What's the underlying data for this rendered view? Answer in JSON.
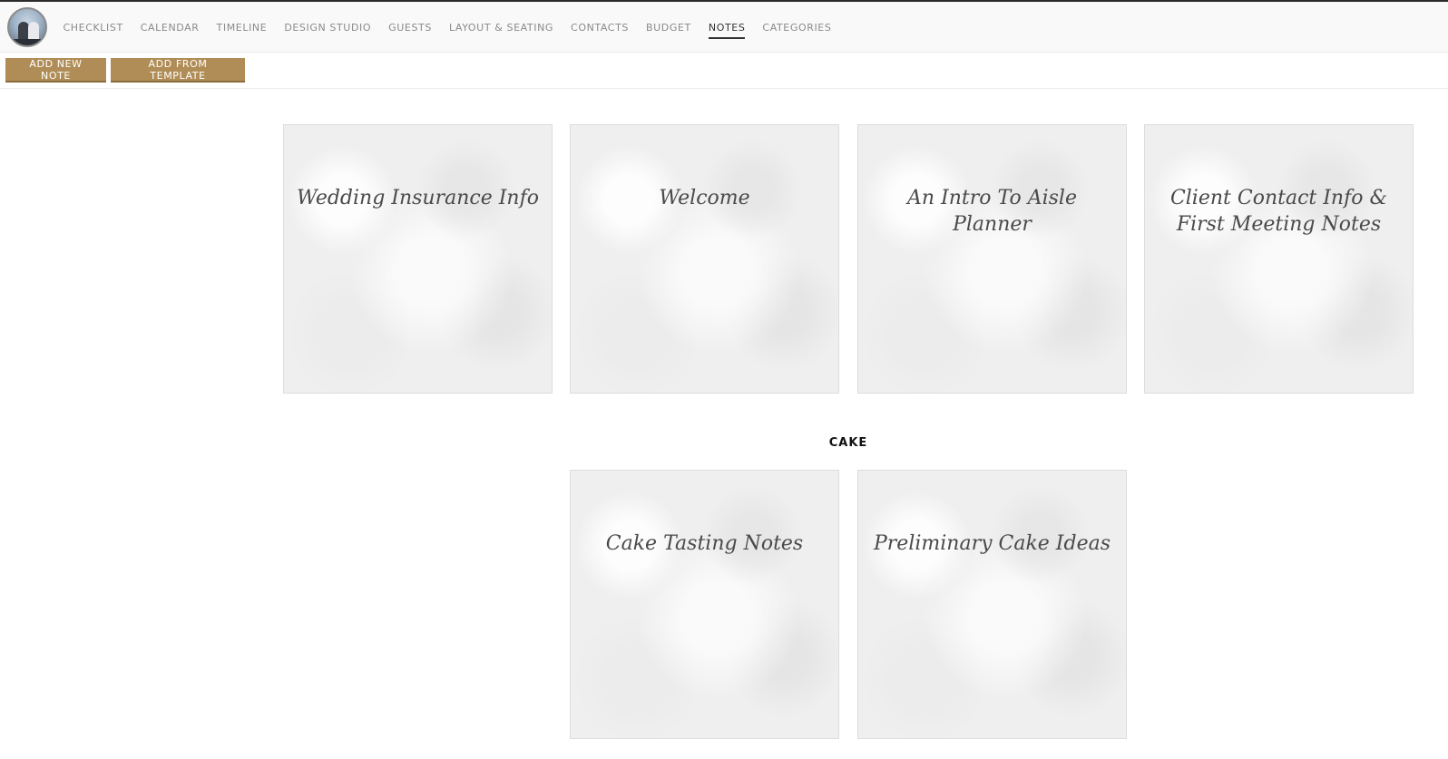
{
  "nav": {
    "items": [
      {
        "label": "CHECKLIST"
      },
      {
        "label": "CALENDAR"
      },
      {
        "label": "TIMELINE"
      },
      {
        "label": "DESIGN STUDIO"
      },
      {
        "label": "GUESTS"
      },
      {
        "label": "LAYOUT & SEATING"
      },
      {
        "label": "CONTACTS"
      },
      {
        "label": "BUDGET"
      },
      {
        "label": "NOTES",
        "active": true
      },
      {
        "label": "CATEGORIES"
      }
    ]
  },
  "toolbar": {
    "add_new_note_label": "ADD NEW NOTE",
    "add_from_template_label": "ADD FROM TEMPLATE",
    "button_color": "#b08d57"
  },
  "notes": {
    "uncategorized": [
      {
        "title": "Wedding Insurance Info"
      },
      {
        "title": "Welcome"
      },
      {
        "title": "An Intro To Aisle Planner"
      },
      {
        "title": "Client Contact Info & First Meeting Notes"
      }
    ],
    "sections": [
      {
        "heading": "CAKE",
        "notes": [
          {
            "title": "Cake Tasting Notes"
          },
          {
            "title": "Preliminary Cake Ideas"
          }
        ]
      }
    ]
  }
}
